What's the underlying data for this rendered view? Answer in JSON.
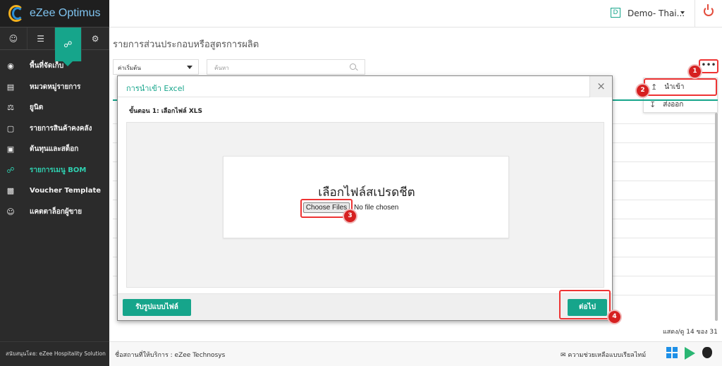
{
  "app": {
    "name": "eZee Optimus"
  },
  "header": {
    "property_initial": "D",
    "property_name": "Demo- Thai..."
  },
  "sidebar": {
    "tabs": [
      "user-icon",
      "list-icon",
      "cart-icon",
      "gear-icon"
    ],
    "items": [
      {
        "label": "พื้นที่จัดเก็บ",
        "icon": "location-pin-icon"
      },
      {
        "label": "หมวดหมู่รายการ",
        "icon": "category-icon"
      },
      {
        "label": "ยูนิต",
        "icon": "scale-icon"
      },
      {
        "label": "รายการสินค้าคงคลัง",
        "icon": "box-icon"
      },
      {
        "label": "ต้นทุนและสต็อก",
        "icon": "money-icon"
      },
      {
        "label": "รายการเมนู BOM",
        "icon": "cart-icon"
      },
      {
        "label": "Voucher Template",
        "icon": "voucher-icon"
      },
      {
        "label": "แคตตาล็อกผู้ขาย",
        "icon": "vendor-icon"
      }
    ],
    "footer": "สนับสนุนโดย: eZee Hospitality Solution"
  },
  "main": {
    "title": "รายการส่วนประกอบหรือสูตรการผลิต",
    "filter_value": "ค่าเริ่มต้น",
    "search_placeholder": "ค้นหา",
    "more_label": "•••",
    "menu": {
      "import_label": "นำเข้า",
      "export_label": "ส่งออก"
    },
    "pager": "แสดง/ดู 14 ของ 31"
  },
  "modal": {
    "title": "การนำเข้า Excel",
    "close": "×",
    "step": "ขั้นตอน 1: เลือกไฟล์ XLS",
    "upload_title": "เลือกไฟล์สเปรดชีต",
    "choose_button": "Choose Files",
    "no_file": "No file chosen",
    "template_button": "รับรูปแบบไฟล์",
    "next_button": "ต่อไป"
  },
  "markers": [
    "1",
    "2",
    "3",
    "4"
  ],
  "footer": {
    "provider": "ชื่อสถานที่ให้บริการ : eZee Technosys",
    "help": "ความช่วยเหลือแบบเรียลไทม์"
  },
  "colors": {
    "accent": "#16a58b",
    "highlight": "#e33333",
    "sidebar_bg": "#2b2b2b"
  }
}
